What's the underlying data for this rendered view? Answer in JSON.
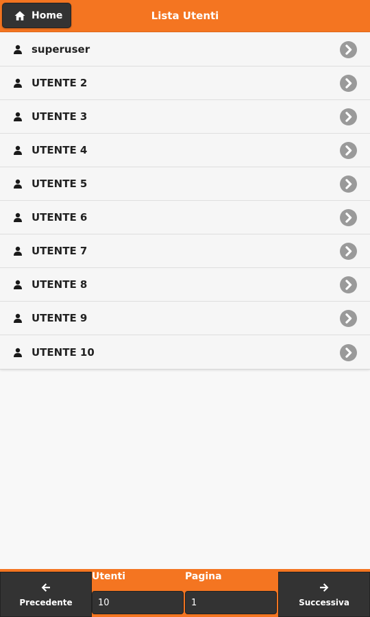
{
  "header": {
    "home_label": "Home",
    "title": "Lista Utenti"
  },
  "users": [
    {
      "label": "superuser"
    },
    {
      "label": "UTENTE 2"
    },
    {
      "label": "UTENTE 3"
    },
    {
      "label": "UTENTE 4"
    },
    {
      "label": "UTENTE 5"
    },
    {
      "label": "UTENTE 6"
    },
    {
      "label": "UTENTE 7"
    },
    {
      "label": "UTENTE 8"
    },
    {
      "label": "UTENTE 9"
    },
    {
      "label": "UTENTE 10"
    }
  ],
  "footer": {
    "prev_label": "Precedente",
    "next_label": "Successiva",
    "users_label": "Utenti",
    "users_value": "10",
    "page_label": "Pagina",
    "page_value": "1"
  },
  "colors": {
    "accent": "#f47521",
    "button_dark": "#333333",
    "chevron": "#9a9a9a"
  },
  "icons": {
    "home": "home-icon",
    "user": "user-icon",
    "row_arrow": "chevron-right-circle-icon",
    "prev": "arrow-left-icon",
    "next": "arrow-right-icon"
  }
}
